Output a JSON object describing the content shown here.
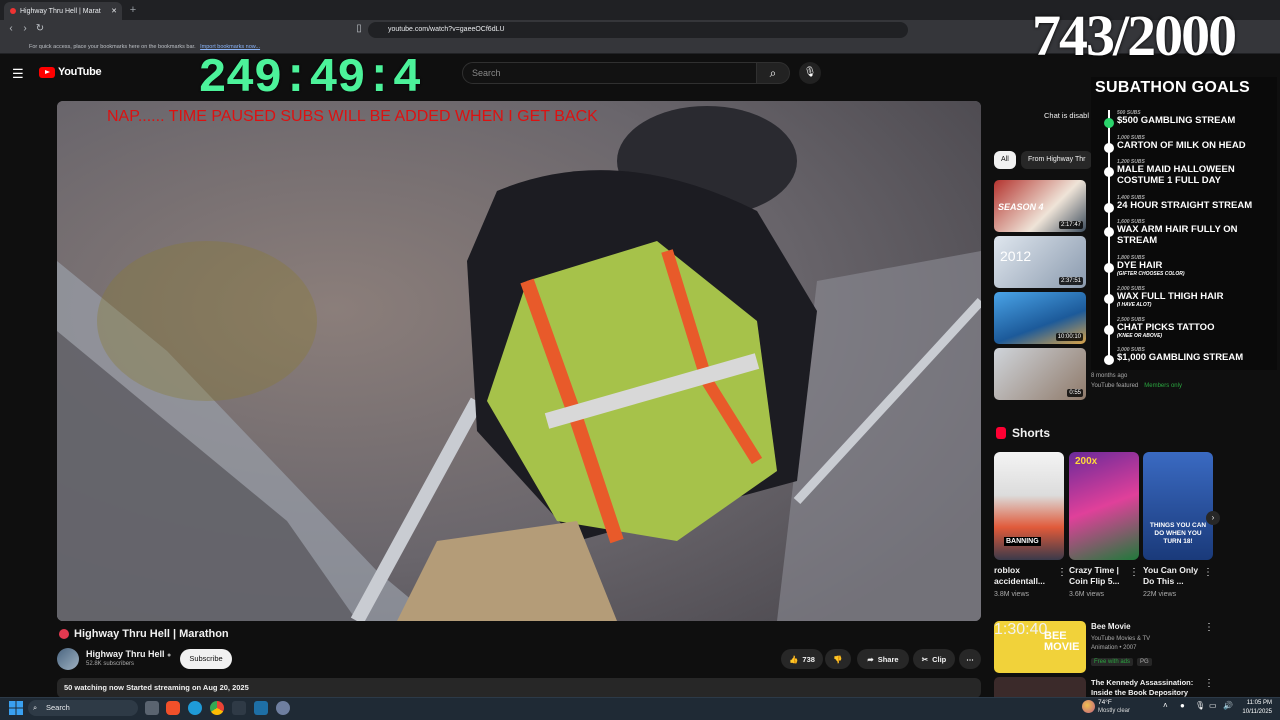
{
  "browser": {
    "tab_title": "Highway Thru Hell | Marat",
    "url": "youtube.com/watch?v=gaeeOCf6dLU",
    "bookmarks_text": "For quick access, place your bookmarks here on the bookmarks bar.",
    "bookmarks_link": "Import bookmarks now..."
  },
  "header": {
    "logo": "YouTube",
    "search_placeholder": "Search"
  },
  "overlay": {
    "timer": "249:49:4",
    "notice": "NAP......  TIME PAUSED SUBS WILL BE ADDED WHEN I GET BACK",
    "counter": "743/2000",
    "goals_title": "SUBATHON GOALS",
    "goals": [
      {
        "subs": "500 SUBS",
        "text": "$500 GAMBLING STREAM",
        "done": true,
        "note": ""
      },
      {
        "subs": "1,000 SUBS",
        "text": "CARTON OF MILK ON HEAD",
        "done": false,
        "note": ""
      },
      {
        "subs": "1,200 SUBS",
        "text": "MALE MAID HALLOWEEN COSTUME 1 FULL DAY",
        "done": false,
        "note": ""
      },
      {
        "subs": "1,400 SUBS",
        "text": "24 HOUR STRAIGHT STREAM",
        "done": false,
        "note": ""
      },
      {
        "subs": "1,600 SUBS",
        "text": "WAX ARM HAIR FULLY ON STREAM",
        "done": false,
        "note": ""
      },
      {
        "subs": "1,800 SUBS",
        "text": "DYE HAIR",
        "done": false,
        "note": "(GIFTER CHOOSES COLOR)"
      },
      {
        "subs": "2,000 SUBS",
        "text": "WAX FULL THIGH HAIR",
        "done": false,
        "note": "(I HAVE ALOT)"
      },
      {
        "subs": "2,500 SUBS",
        "text": "CHAT PICKS TATTOO",
        "done": false,
        "note": "(KNEE OR ABOVE)"
      },
      {
        "subs": "3,000 SUBS",
        "text": "$1,000 GAMBLING STREAM",
        "done": false,
        "note": ""
      }
    ]
  },
  "video": {
    "title": "Highway Thru Hell | Marathon",
    "channel": "Highway Thru Hell",
    "subscribers": "52.8K subscribers",
    "subscribe_label": "Subscribe",
    "likes": "738",
    "share_label": "Share",
    "clip_label": "Clip",
    "description": "50 watching now  Started streaming on Aug 20, 2025"
  },
  "sidebar": {
    "chat_disabled": "Chat is disabl",
    "chips": [
      "All",
      "From Highway Thr"
    ],
    "recs": [
      {
        "duration": "2:17:47",
        "thumb_text": "SEASON 4"
      },
      {
        "duration": "2:37:51",
        "thumb_text": "2012"
      },
      {
        "duration": "10:00:10",
        "thumb_text": ""
      },
      {
        "duration": "0:55",
        "thumb_text": ""
      }
    ],
    "rec_meta": "8 months ago",
    "rec_featured": "YouTube featured",
    "rec_members": "Members only"
  },
  "shorts": {
    "heading": "Shorts",
    "items": [
      {
        "title": "roblox accidentall...",
        "views": "3.8M views",
        "overlay": "BANNING"
      },
      {
        "title": "Crazy Time | Coin Flip 5...",
        "views": "3.6M views",
        "overlay": "200x"
      },
      {
        "title": "You Can Only Do This ...",
        "views": "22M views",
        "overlay": "THINGS YOU CAN DO WHEN YOU TURN 18!"
      }
    ]
  },
  "more": {
    "bee_title": "Bee Movie",
    "bee_channel": "YouTube Movies & TV",
    "bee_info": "Animation • 2007",
    "bee_free": "Free with ads",
    "bee_rating": "PG",
    "bee_duration": "1:30:40",
    "bee_thumb": "BEE MOVIE",
    "kennedy_title": "The Kennedy Assassination: Inside the Book Depository"
  },
  "taskbar": {
    "search": "Search",
    "temp": "74°F",
    "weather": "Mostly clear",
    "time": "11:05 PM",
    "date": "10/11/2025"
  },
  "colors": {
    "timer": "#4cf29a",
    "notice": "#dd1111",
    "youtube_red": "#ff0000",
    "members": "#2ba640"
  }
}
